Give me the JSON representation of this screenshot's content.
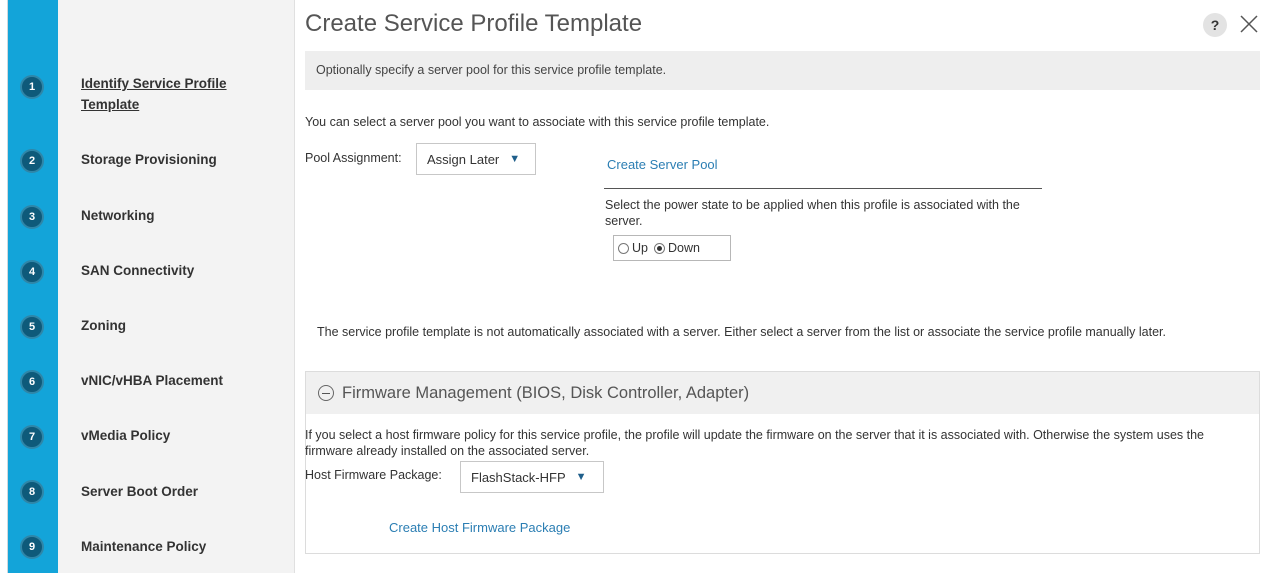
{
  "window": {
    "title": "Create Service Profile Template",
    "help_label": "?"
  },
  "steps": [
    {
      "num": "1",
      "label": "Identify Service Profile Template",
      "active": true
    },
    {
      "num": "2",
      "label": "Storage Provisioning"
    },
    {
      "num": "3",
      "label": "Networking"
    },
    {
      "num": "4",
      "label": "SAN Connectivity"
    },
    {
      "num": "5",
      "label": "Zoning"
    },
    {
      "num": "6",
      "label": "vNIC/vHBA Placement"
    },
    {
      "num": "7",
      "label": "vMedia Policy"
    },
    {
      "num": "8",
      "label": "Server Boot Order"
    },
    {
      "num": "9",
      "label": "Maintenance Policy"
    }
  ],
  "main": {
    "banner": "Optionally specify a server pool for this service profile template.",
    "pool_intro": "You can select a server pool you want to associate with this service profile template.",
    "pool_label": "Pool Assignment:",
    "pool_value": "Assign Later",
    "create_pool_link": "Create Server Pool",
    "power_text": "Select the power state to be applied when this profile is associated with the server.",
    "power_options": [
      "Up",
      "Down"
    ],
    "power_selected": "Down",
    "assoc_note": "The service profile template is not automatically associated with a server. Either select a server from the list or associate the service profile manually later."
  },
  "firmware": {
    "header": "Firmware Management (BIOS, Disk Controller, Adapter)",
    "desc": "If you select a host firmware policy for this service profile, the profile will update the firmware on the server that it is associated with. Otherwise the system uses the firmware already installed on the associated server.",
    "package_label": "Host Firmware Package:",
    "package_value": "FlashStack-HFP",
    "create_link": "Create Host Firmware Package"
  },
  "colors": {
    "rail": "#13a4d9",
    "step_circle": "#0e5a7a",
    "link": "#2b7eb3"
  }
}
